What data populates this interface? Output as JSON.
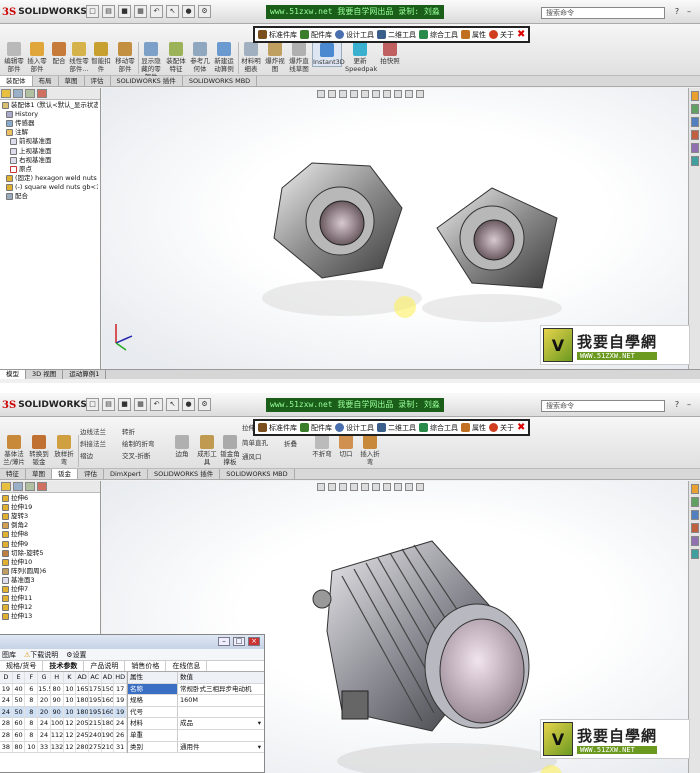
{
  "watermark_text": "www.51zxw.net 我要自学网出品 录制: 刘淼",
  "search_placeholder": "搜索命令",
  "logo": {
    "ds": "3S",
    "sw": "SOLIDWORKS"
  },
  "addin_toolbar": [
    {
      "label": "标准件库",
      "color": "#7a4f1d"
    },
    {
      "label": "配件库",
      "color": "#3a7d2b"
    },
    {
      "label": "设计工具",
      "color": "#4a6fb0"
    },
    {
      "label": "二维工具",
      "color": "#3a5f8a"
    },
    {
      "label": "综合工具",
      "color": "#2a8a4a"
    },
    {
      "label": "属性",
      "color": "#c07020"
    },
    {
      "label": "关于",
      "color": "#d04020"
    }
  ],
  "shot1": {
    "command_buttons": [
      "编辑零部件",
      "插入零部件",
      "配合",
      "线性零部件...",
      "智能扣件",
      "移动零部件",
      "显示隐藏的零部件",
      "装配体特征",
      "参考几何体",
      "新建运动算例",
      "材料明细表",
      "爆炸视图",
      "爆炸直线草图",
      "Instant3D",
      "更新Speedpak",
      "拍快照"
    ],
    "tabs": [
      "装配体",
      "布局",
      "草图",
      "评估",
      "SOLIDWORKS 插件",
      "SOLIDWORKS MBD"
    ],
    "tree": [
      "装配体1 (默认<默认_显示状态-",
      "History",
      "传感器",
      "注解",
      "前视基准面",
      "上视基准面",
      "右视基准面",
      "原点",
      "(固定) hexagon weld nuts",
      "(-) square weld nuts gb<1",
      "配合"
    ],
    "status_tabs": [
      "模型",
      "3D 视图",
      "运动算例1"
    ]
  },
  "shot2": {
    "command_buttons": [
      "基体法兰/薄片",
      "转换到钣金",
      "放样折弯",
      "边线法兰",
      "斜接法兰",
      "褶边",
      "转折",
      "绘制的折弯",
      "交叉-折断",
      "边角",
      "成形工具",
      "钣金角撑板",
      "拉伸切除",
      "简单直孔",
      "通风口",
      "展开",
      "折叠",
      "不折弯",
      "切口",
      "插入折弯"
    ],
    "tabs": [
      "特征",
      "草图",
      "钣金",
      "评估",
      "DimXpert",
      "SOLIDWORKS 插件",
      "SOLIDWORKS MBD"
    ],
    "tree": [
      "拉伸6",
      "拉伸19",
      "旋转3",
      "倒角2",
      "拉伸8",
      "拉伸9",
      "切除-旋转5",
      "拉伸10",
      "阵列(圆周)6",
      "基准面3",
      "拉伸7",
      "拉伸11",
      "拉伸12",
      "拉伸13"
    ],
    "dialog": {
      "toolbar": [
        "图库",
        "下载说明",
        "设置"
      ],
      "tabs": [
        "规格/货号",
        "技术参数",
        "产品说明",
        "销售价格",
        "在线信息"
      ],
      "grid_header": [
        "D",
        "E",
        "F",
        "G",
        "H",
        "K",
        "AD",
        "AC",
        "AD",
        "HD"
      ],
      "grid_rows": [
        [
          "19",
          "40",
          "6",
          "15.5",
          "80",
          "10",
          "165",
          "175",
          "150",
          "17"
        ],
        [
          "24",
          "50",
          "8",
          "20",
          "90",
          "10",
          "180",
          "195",
          "160",
          "19"
        ],
        [
          "24",
          "50",
          "8",
          "20",
          "90",
          "10",
          "180",
          "195",
          "160",
          "19"
        ],
        [
          "28",
          "60",
          "8",
          "24",
          "100",
          "12",
          "205",
          "215",
          "180",
          "24"
        ],
        [
          "28",
          "60",
          "8",
          "24",
          "112",
          "12",
          "245",
          "240",
          "190",
          "26"
        ],
        [
          "38",
          "80",
          "10",
          "33",
          "132",
          "12",
          "280",
          "275",
          "210",
          "31"
        ]
      ],
      "prop_header": [
        "属性",
        "数值"
      ],
      "props": [
        [
          "名称",
          "常规卧式三相异步电动机"
        ],
        [
          "规格",
          "160M"
        ],
        [
          "代号",
          ""
        ],
        [
          "材料",
          "成品"
        ],
        [
          "单重",
          ""
        ],
        [
          "类别",
          "通用件"
        ]
      ]
    }
  },
  "brand": {
    "name": "我要自學網",
    "url": "WWW.51ZXW.NET"
  }
}
